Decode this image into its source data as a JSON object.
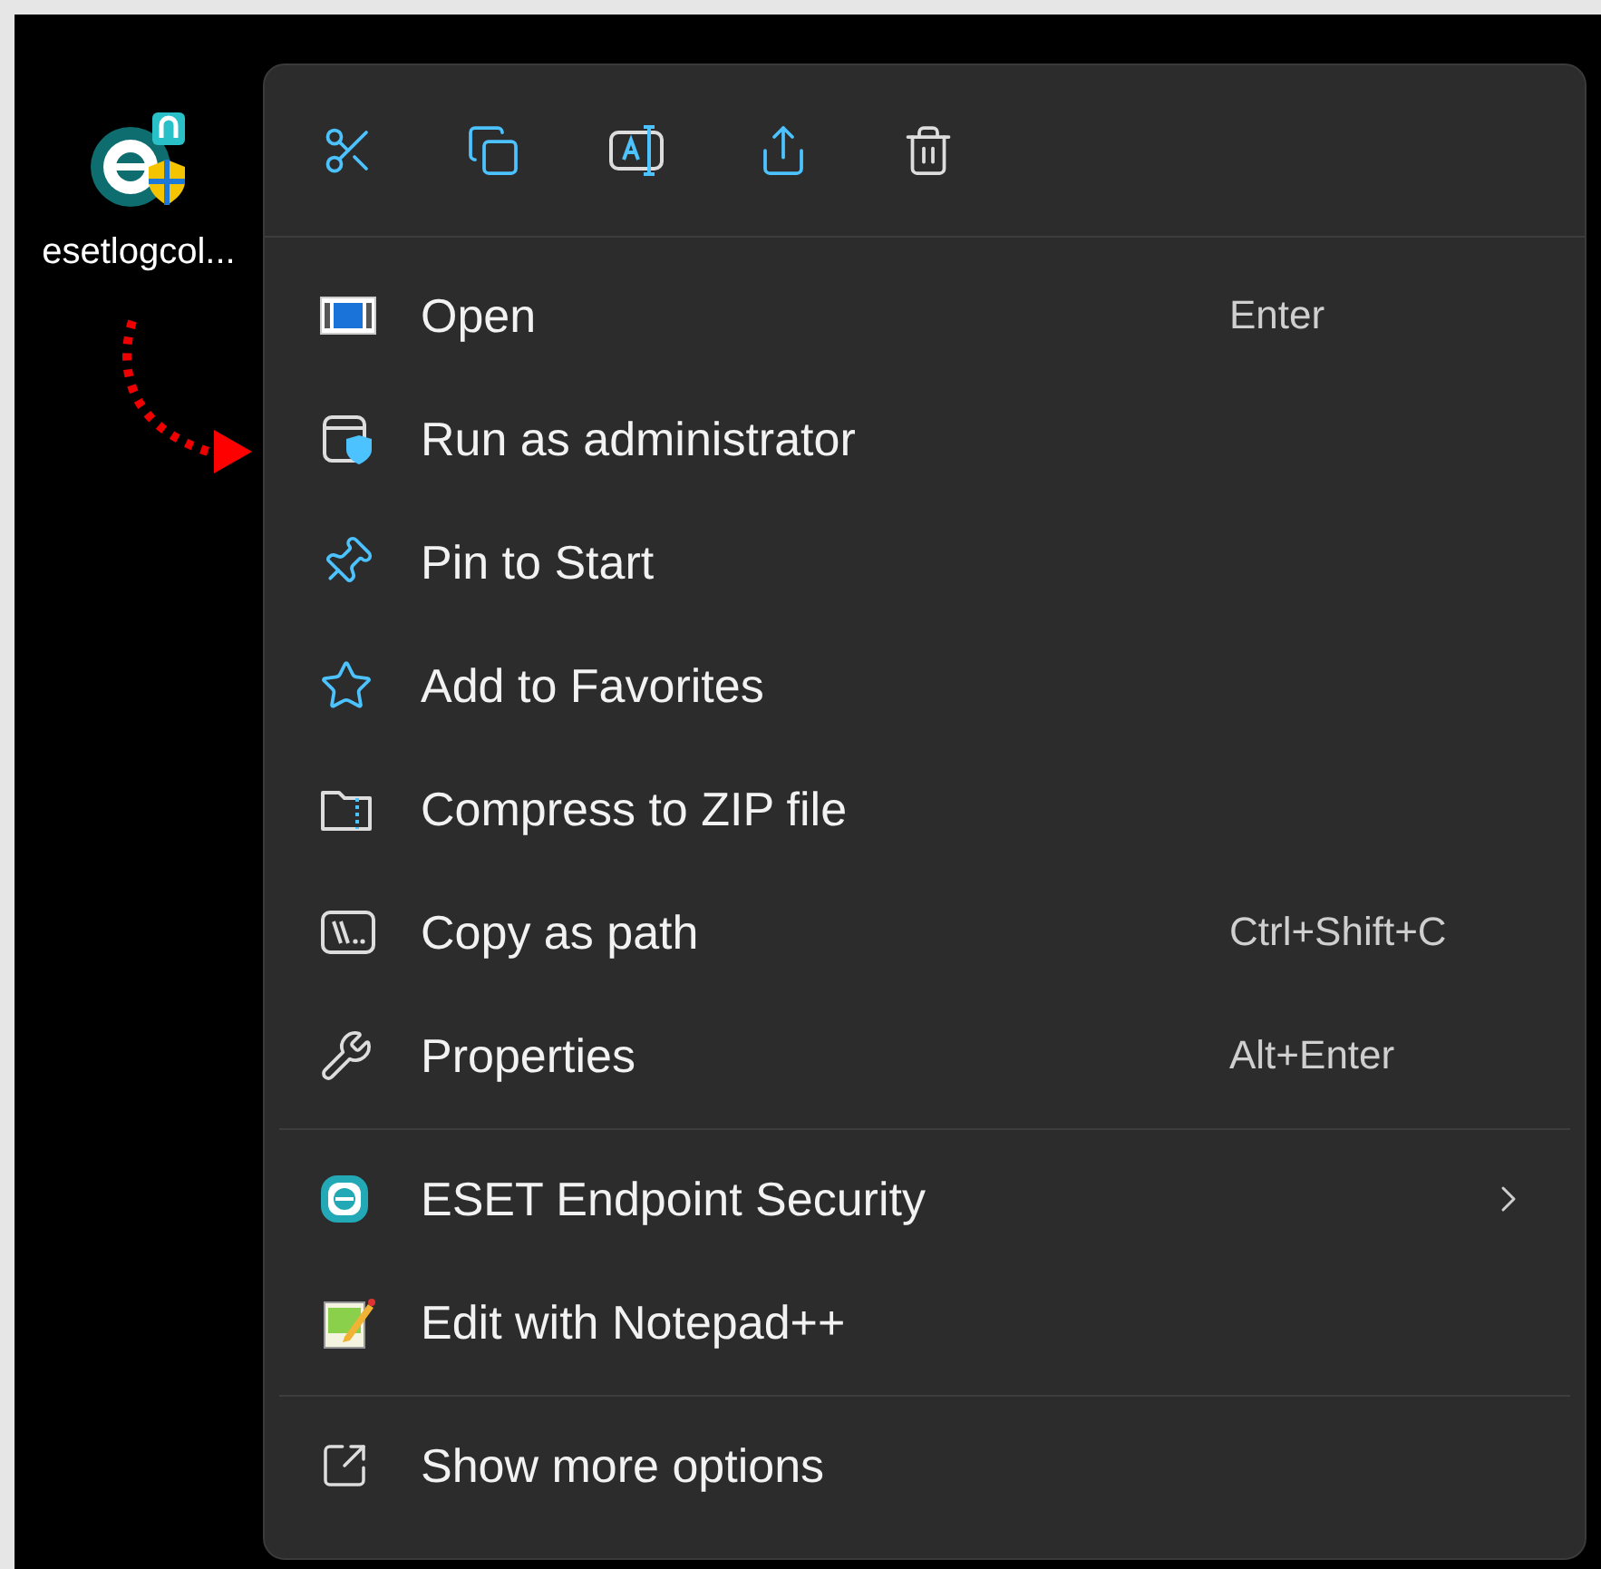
{
  "desktop_icon": {
    "label": "esetlogcol..."
  },
  "context_menu": {
    "groups": [
      [
        {
          "label": "Open",
          "shortcut": "Enter",
          "submenu": false
        },
        {
          "label": "Run as administrator",
          "submenu": false
        },
        {
          "label": "Pin to Start",
          "submenu": false
        },
        {
          "label": "Add to Favorites",
          "submenu": false
        },
        {
          "label": "Compress to ZIP file",
          "submenu": false
        },
        {
          "label": "Copy as path",
          "shortcut": "Ctrl+Shift+C",
          "submenu": false
        },
        {
          "label": "Properties",
          "shortcut": "Alt+Enter",
          "submenu": false
        }
      ],
      [
        {
          "label": "ESET Endpoint Security",
          "submenu": true
        },
        {
          "label": "Edit with Notepad++",
          "submenu": false
        }
      ],
      [
        {
          "label": "Show more options",
          "submenu": false
        }
      ]
    ]
  }
}
